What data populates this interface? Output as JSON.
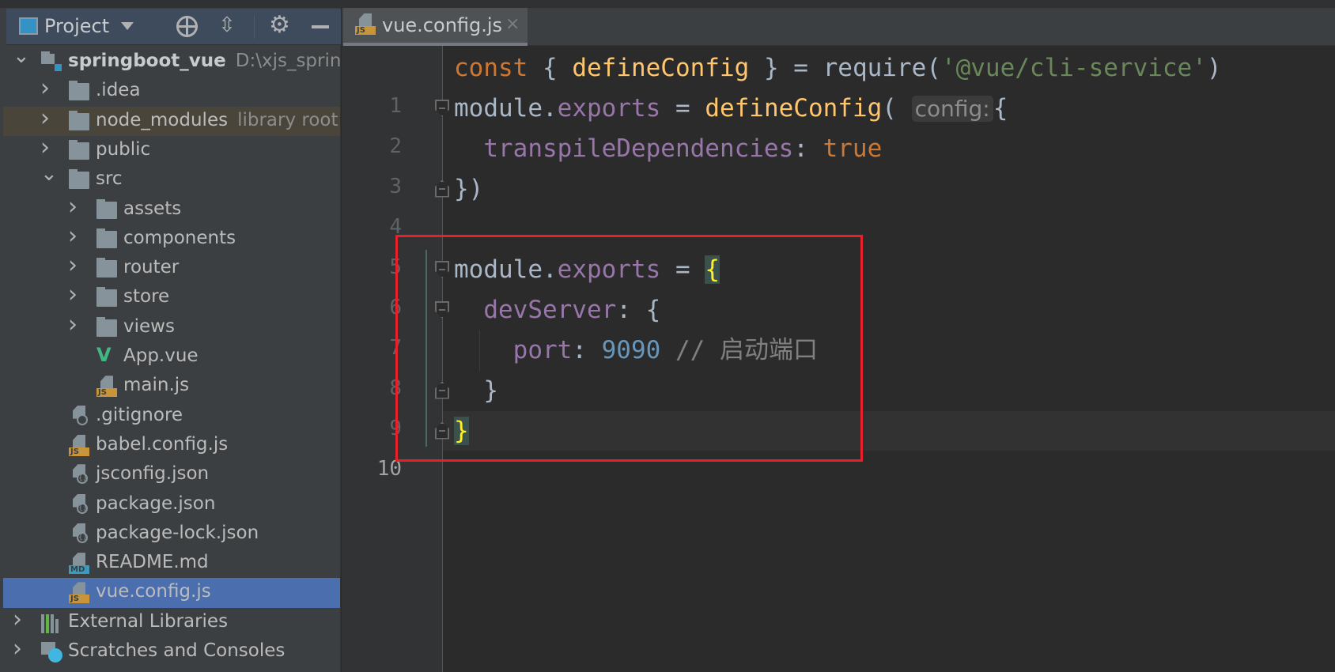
{
  "project_panel": {
    "title": "Project",
    "tree": [
      {
        "label": "springboot_vue",
        "extra": "D:\\xjs_spring",
        "level": 0,
        "chevron": "down",
        "icon": "project-folder",
        "bold": true
      },
      {
        "label": ".idea",
        "level": 1,
        "chevron": "right",
        "icon": "folder"
      },
      {
        "label": "node_modules",
        "extra": "library root",
        "level": 1,
        "chevron": "right",
        "icon": "folder",
        "highlight": "library"
      },
      {
        "label": "public",
        "level": 1,
        "chevron": "right",
        "icon": "folder"
      },
      {
        "label": "src",
        "level": 1,
        "chevron": "down",
        "icon": "folder"
      },
      {
        "label": "assets",
        "level": 2,
        "chevron": "right",
        "icon": "folder"
      },
      {
        "label": "components",
        "level": 2,
        "chevron": "right",
        "icon": "folder"
      },
      {
        "label": "router",
        "level": 2,
        "chevron": "right",
        "icon": "folder"
      },
      {
        "label": "store",
        "level": 2,
        "chevron": "right",
        "icon": "folder"
      },
      {
        "label": "views",
        "level": 2,
        "chevron": "right",
        "icon": "folder"
      },
      {
        "label": "App.vue",
        "level": 2,
        "icon": "vue"
      },
      {
        "label": "main.js",
        "level": 2,
        "icon": "js"
      },
      {
        "label": ".gitignore",
        "level": 1,
        "icon": "gitignore"
      },
      {
        "label": "babel.config.js",
        "level": 1,
        "icon": "js"
      },
      {
        "label": "jsconfig.json",
        "level": 1,
        "icon": "json"
      },
      {
        "label": "package.json",
        "level": 1,
        "icon": "json"
      },
      {
        "label": "package-lock.json",
        "level": 1,
        "icon": "json"
      },
      {
        "label": "README.md",
        "level": 1,
        "icon": "md"
      },
      {
        "label": "vue.config.js",
        "level": 1,
        "icon": "js",
        "selected": true
      },
      {
        "label": "External Libraries",
        "level": 0,
        "chevron": "right",
        "icon": "libraries"
      },
      {
        "label": "Scratches and Consoles",
        "level": 0,
        "chevron": "right",
        "icon": "scratches"
      }
    ]
  },
  "editor": {
    "tab": {
      "label": "vue.config.js",
      "close": "×"
    },
    "current_line": 10,
    "lines": [
      [
        {
          "t": "keyword",
          "v": "const"
        },
        {
          "t": "plain",
          "v": " { "
        },
        {
          "t": "fn",
          "v": "defineConfig"
        },
        {
          "t": "plain",
          "v": " } = require("
        },
        {
          "t": "string",
          "v": "'@vue/cli-service'"
        },
        {
          "t": "plain",
          "v": ")"
        }
      ],
      [
        {
          "t": "plain",
          "v": "module."
        },
        {
          "t": "prop",
          "v": "exports"
        },
        {
          "t": "plain",
          "v": " = "
        },
        {
          "t": "fn",
          "v": "defineConfig"
        },
        {
          "t": "plain",
          "v": "( "
        },
        {
          "t": "hint",
          "v": "config:"
        },
        {
          "t": "plain",
          "v": "{"
        }
      ],
      [
        {
          "t": "plain",
          "v": "  "
        },
        {
          "t": "prop",
          "v": "transpileDependencies"
        },
        {
          "t": "plain",
          "v": ": "
        },
        {
          "t": "keyword",
          "v": "true"
        }
      ],
      [
        {
          "t": "plain",
          "v": "})"
        }
      ],
      [],
      [
        {
          "t": "plain",
          "v": "module."
        },
        {
          "t": "prop",
          "v": "exports"
        },
        {
          "t": "plain",
          "v": " = "
        },
        {
          "t": "brace-match",
          "v": "{"
        }
      ],
      [
        {
          "t": "plain",
          "v": "  "
        },
        {
          "t": "prop",
          "v": "devServer"
        },
        {
          "t": "plain",
          "v": ": {"
        }
      ],
      [
        {
          "t": "plain",
          "v": "    "
        },
        {
          "t": "prop",
          "v": "port"
        },
        {
          "t": "plain",
          "v": ": "
        },
        {
          "t": "number",
          "v": "9090"
        },
        {
          "t": "comment",
          "v": " // 启动端口"
        }
      ],
      [
        {
          "t": "plain",
          "v": "  }"
        }
      ],
      [
        {
          "t": "brace-match",
          "v": "}"
        }
      ]
    ]
  },
  "colors": {
    "annotation_box": "#e8202a",
    "selection": "#4b6eaf",
    "editor_bg": "#2b2b2b",
    "sidebar_bg": "#3c3f41"
  }
}
